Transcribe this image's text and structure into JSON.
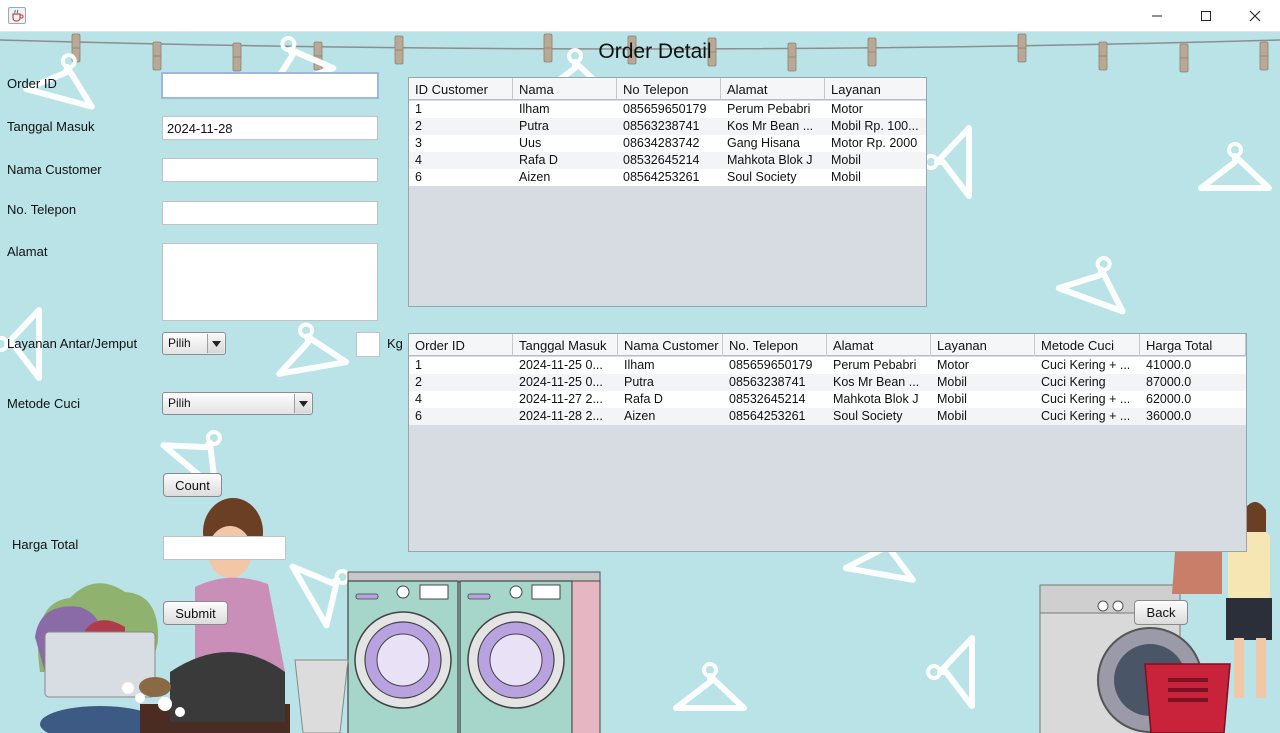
{
  "window": {
    "app_icon": "java-cup-icon",
    "controls": [
      "minimize-icon",
      "maximize-icon",
      "close-icon"
    ]
  },
  "page_title": "Order Detail",
  "form": {
    "order_id": {
      "label": "Order ID",
      "value": ""
    },
    "tanggal_masuk": {
      "label": "Tanggal Masuk",
      "value": "2024-11-28"
    },
    "nama_customer": {
      "label": "Nama Customer",
      "value": ""
    },
    "no_telepon": {
      "label": "No. Telepon",
      "value": ""
    },
    "alamat": {
      "label": "Alamat",
      "value": ""
    },
    "layanan": {
      "label": "Layanan Antar/Jemput",
      "selected": "Pilih"
    },
    "weight": {
      "value": "",
      "unit": "Kg"
    },
    "metode_cuci": {
      "label": "Metode Cuci",
      "selected": "Pilih"
    },
    "count_button": "Count",
    "harga_total": {
      "label": "Harga Total",
      "value": ""
    },
    "submit_button": "Submit"
  },
  "back_button": "Back",
  "customer_table": {
    "columns": [
      "ID Customer",
      "Nama",
      "No Telepon",
      "Alamat",
      "Layanan"
    ],
    "rows": [
      [
        "1",
        "Ilham",
        "085659650179",
        "Perum Pebabri",
        "Motor"
      ],
      [
        "2",
        "Putra",
        "08563238741",
        "Kos Mr Bean ...",
        "Mobil Rp. 100..."
      ],
      [
        "3",
        "Uus",
        "08634283742",
        "Gang Hisana",
        "Motor Rp. 2000"
      ],
      [
        "4",
        "Rafa D",
        "08532645214",
        "Mahkota Blok J",
        "Mobil"
      ],
      [
        "6",
        "Aizen",
        "08564253261",
        "Soul Society",
        "Mobil"
      ]
    ]
  },
  "order_table": {
    "columns": [
      "Order ID",
      "Tanggal Masuk",
      "Nama Customer",
      "No. Telepon",
      "Alamat",
      "Layanan",
      "Metode Cuci",
      "Harga Total"
    ],
    "rows": [
      [
        "1",
        "2024-11-25 0...",
        "Ilham",
        "085659650179",
        "Perum Pebabri",
        "Motor",
        "Cuci Kering + ...",
        "41000.0"
      ],
      [
        "2",
        "2024-11-25 0...",
        "Putra",
        "08563238741",
        "Kos Mr Bean ...",
        "Mobil",
        "Cuci Kering",
        "87000.0"
      ],
      [
        "4",
        "2024-11-27 2...",
        "Rafa D",
        "08532645214",
        "Mahkota Blok J",
        "Mobil",
        "Cuci Kering + ...",
        "62000.0"
      ],
      [
        "6",
        "2024-11-28 2...",
        "Aizen",
        "08564253261",
        "Soul Society",
        "Mobil",
        "Cuci Kering + ...",
        "36000.0"
      ]
    ]
  },
  "colors": {
    "background": "#b9e3e6",
    "table_empty_area": "#d7dce2",
    "hanger": "#ffffff",
    "clothesline_peg": "#b9a896",
    "washer_body": "#a6d6c9",
    "washer_drum": "#b9a2e0"
  },
  "decorations": [
    "clothesline",
    "clothespin-icon",
    "hanger-icon",
    "washing-machine",
    "laundry-basket",
    "woman-washing-clothes",
    "woman-hanging-clothes"
  ]
}
